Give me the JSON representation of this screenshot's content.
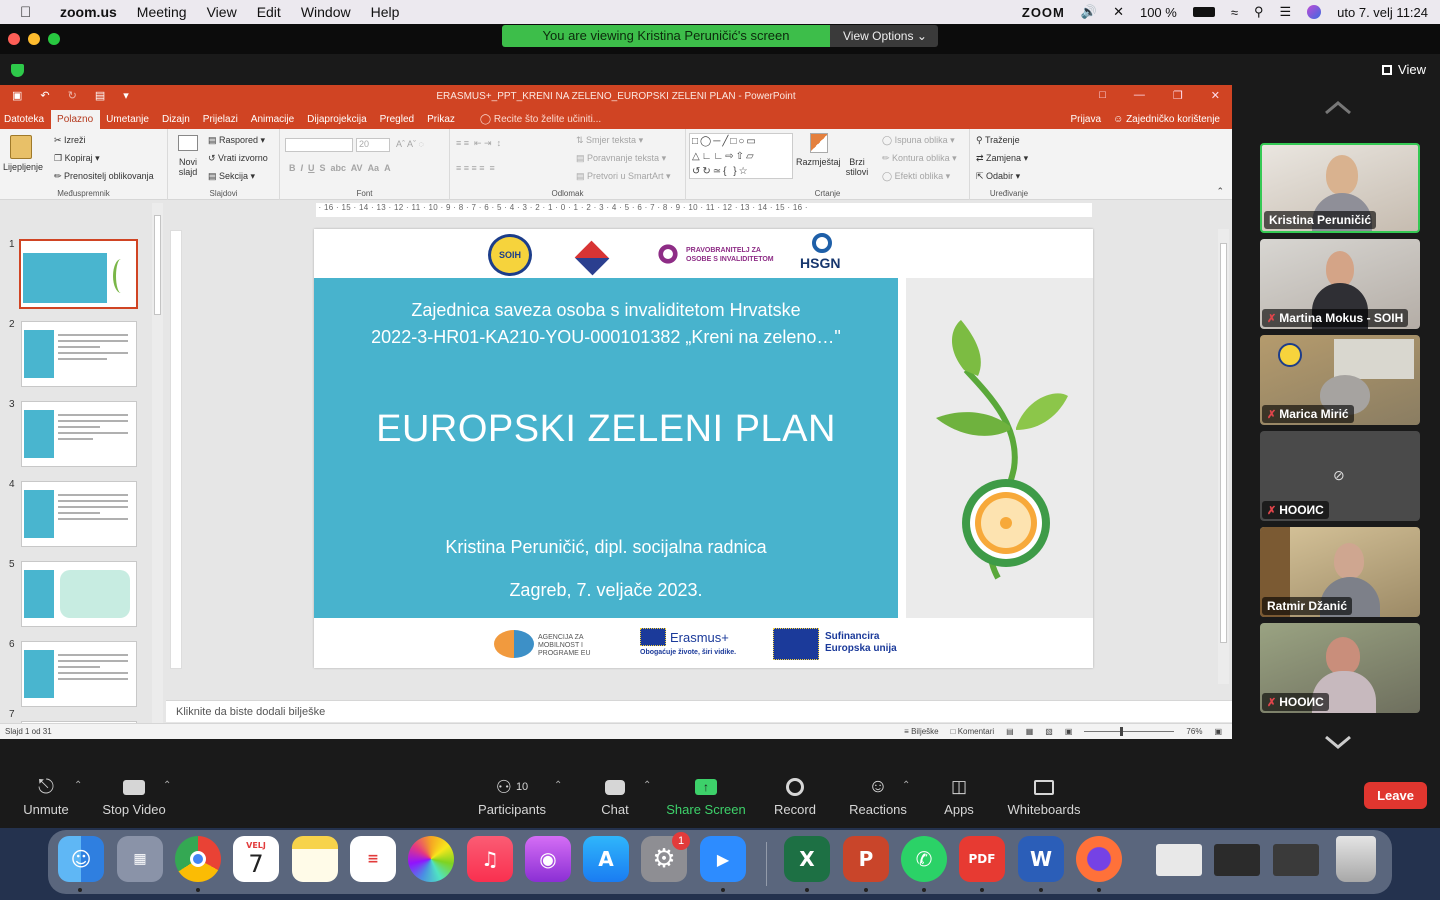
{
  "menubar": {
    "app": "zoom.us",
    "items": [
      "Meeting",
      "View",
      "Edit",
      "Window",
      "Help"
    ],
    "zoom_label": "ZOOM",
    "battery": "100 %",
    "datetime": "uto 7. velj  11:24"
  },
  "zoom": {
    "viewing_banner": "You are viewing Kristina Peruničić's screen",
    "view_options": "View Options",
    "view_button": "View"
  },
  "ppt": {
    "window_title": "ERASMUS+_PPT_KRENI NA ZELENO_EUROPSKI ZELENI PLAN - PowerPoint",
    "tabs": [
      "Datoteka",
      "Polazno",
      "Umetanje",
      "Dizajn",
      "Prijelazi",
      "Animacije",
      "Dijaprojekcija",
      "Pregled",
      "Prikaz"
    ],
    "tell_me": "Recite što želite učiniti...",
    "signin": "Prijava",
    "share": "Zajedničko korištenje",
    "ribbon": {
      "clipboard": {
        "paste": "Lijepljenje",
        "cut": "Izreži",
        "copy": "Kopiraj",
        "format_painter": "Prenositelj oblikovanja",
        "label": "Međuspremnik"
      },
      "slides": {
        "new_slide": "Novi slajd",
        "layout": "Raspored",
        "reset": "Vrati izvorno",
        "section": "Sekcija",
        "label": "Slajdovi"
      },
      "font": {
        "size": "20",
        "label": "Font"
      },
      "paragraph": {
        "text_direction": "Smjer teksta",
        "align_text": "Poravnanje teksta",
        "smartart": "Pretvori u SmartArt",
        "label": "Odlomak"
      },
      "drawing": {
        "arrange": "Razmještaj",
        "quick_styles": "Brzi stilovi",
        "fill": "Ispuna oblika",
        "outline": "Kontura oblika",
        "effects": "Efekti oblika",
        "label": "Crtanje"
      },
      "editing": {
        "find": "Traženje",
        "replace": "Zamjena",
        "select": "Odabir",
        "label": "Uređivanje"
      }
    },
    "slide_numbers": [
      "1",
      "2",
      "3",
      "4",
      "5",
      "6",
      "7"
    ],
    "slide": {
      "org": "Zajednica saveza osoba s invaliditetom Hrvatske",
      "project": "2022-3-HR01-KA210-YOU-000101382 „Kreni na zeleno…\"",
      "title": "EUROPSKI ZELENI PLAN",
      "author": "Kristina Peruničić, dipl. socijalna radnica",
      "date": "Zagreb, 7. veljače 2023.",
      "logos_top": {
        "soih": "SOIH",
        "pravobranitelj_1": "PRAVOBRANITELJ ZA",
        "pravobranitelj_2": "OSOBE S INVALIDITETOM",
        "hsgn": "HSGN"
      },
      "logos_bottom": {
        "agency_1": "AGENCIJA ZA",
        "agency_2": "MOBILNOST I",
        "agency_3": "PROGRAME EU",
        "erasmus": "Erasmus+",
        "erasmus_tag": "Obogaćuje živote, širi vidike.",
        "eu_1": "Sufinancira",
        "eu_2": "Europska unija"
      }
    },
    "notes_placeholder": "Kliknite da biste dodali bilješke",
    "status": {
      "slide_count": "Slajd 1 od 31",
      "notes": "Bilješke",
      "comments": "Komentari",
      "zoom": "76%"
    }
  },
  "participants": [
    {
      "name": "Kristina Peruničić",
      "muted": false,
      "active": true
    },
    {
      "name": "Martina Mokus - SOIH",
      "muted": true,
      "active": false
    },
    {
      "name": "Marica Mirić",
      "muted": true,
      "active": false
    },
    {
      "name": "НООИС",
      "muted": true,
      "active": false,
      "video_off": true
    },
    {
      "name": "Ratmir Džanić",
      "muted": false,
      "active": false
    },
    {
      "name": "НООИС",
      "muted": true,
      "active": false
    }
  ],
  "toolbar": {
    "unmute": "Unmute",
    "stop_video": "Stop Video",
    "participants": "Participants",
    "participant_count": "10",
    "chat": "Chat",
    "share": "Share Screen",
    "record": "Record",
    "reactions": "Reactions",
    "apps": "Apps",
    "whiteboards": "Whiteboards",
    "leave": "Leave"
  },
  "dock": {
    "calendar_month": "VELJ",
    "calendar_day": "7",
    "settings_badge": "1"
  },
  "colors": {
    "ppt_accent": "#d04423",
    "slide_blue": "#48b3cd",
    "zoom_green": "#3dbe4a",
    "leave_red": "#e0362f"
  }
}
